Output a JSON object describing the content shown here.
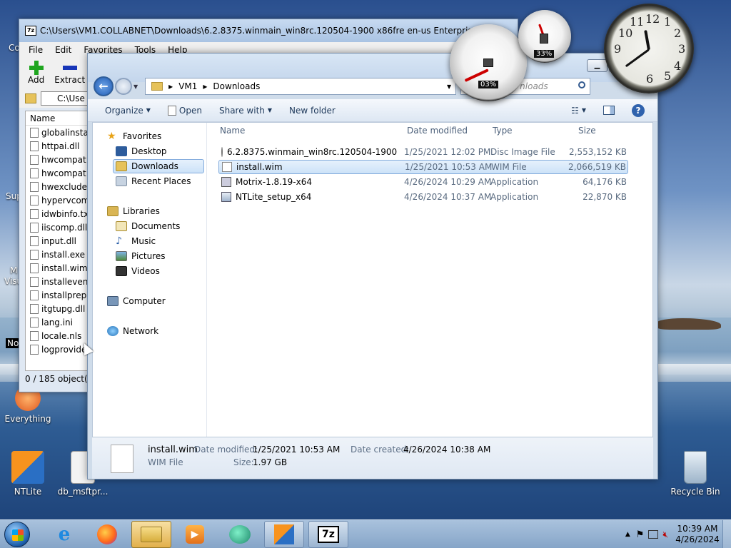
{
  "desktop": {
    "icons": [
      {
        "label": "Everything"
      },
      {
        "label": "NTLite"
      },
      {
        "label": "db_msftpr..."
      },
      {
        "label": "Recycle Bin"
      }
    ],
    "edge_labels": [
      "Co",
      "Sup",
      "M",
      "Visu",
      "No"
    ]
  },
  "sevenzip": {
    "title": "C:\\Users\\VM1.COLLABNET\\Downloads\\6.2.8375.winmain_win8rc.120504-1900 x86fre en-us Enterprise.iso\\sources\\",
    "menu": [
      "File",
      "Edit",
      "Favorites",
      "Tools",
      "Help"
    ],
    "toolbar": {
      "add": "Add",
      "extract": "Extract"
    },
    "address": "C:\\Use",
    "column_name": "Name",
    "files": [
      "globalinstall",
      "httpai.dll",
      "hwcompat.d",
      "hwcompat.t",
      "hwexclude.t",
      "hypervcomp",
      "idwbinfo.txt",
      "iiscomp.dll",
      "input.dll",
      "install.exe",
      "install.wim",
      "installeventr",
      "installprep.e",
      "itgtupg.dll",
      "lang.ini",
      "locale.nls",
      "logprovide"
    ],
    "status": "0 / 185 object(s)"
  },
  "explorer": {
    "breadcrumb": [
      "VM1",
      "Downloads"
    ],
    "search_placeholder": "Search Downloads",
    "search_visible": "nloads",
    "commands": {
      "organize": "Organize",
      "open": "Open",
      "share_with": "Share with",
      "new_folder": "New folder"
    },
    "nav": {
      "favorites": "Favorites",
      "desktop": "Desktop",
      "downloads": "Downloads",
      "recent": "Recent Places",
      "libraries": "Libraries",
      "documents": "Documents",
      "music": "Music",
      "pictures": "Pictures",
      "videos": "Videos",
      "computer": "Computer",
      "network": "Network"
    },
    "columns": {
      "name": "Name",
      "date": "Date modified",
      "type": "Type",
      "size": "Size"
    },
    "files": [
      {
        "name": "6.2.8375.winmain_win8rc.120504-1900 x8...",
        "date": "1/25/2021 12:02 PM",
        "type": "Disc Image File",
        "size": "2,553,152 KB"
      },
      {
        "name": "install.wim",
        "date": "1/25/2021 10:53 AM",
        "type": "WIM File",
        "size": "2,066,519 KB"
      },
      {
        "name": "Motrix-1.8.19-x64",
        "date": "4/26/2024 10:29 AM",
        "type": "Application",
        "size": "64,176 KB"
      },
      {
        "name": "NTLite_setup_x64",
        "date": "4/26/2024 10:37 AM",
        "type": "Application",
        "size": "22,870 KB"
      }
    ],
    "details": {
      "name": "install.wim",
      "type": "WIM File",
      "date_modified_label": "Date modified:",
      "date_modified": "1/25/2021 10:53 AM",
      "date_created_label": "Date created:",
      "date_created": "4/26/2024 10:38 AM",
      "size_label": "Size:",
      "size": "1.97 GB"
    }
  },
  "gadgets": {
    "cpu": "03%",
    "mem": "33%"
  },
  "taskbar": {
    "time": "10:39 AM",
    "date": "4/26/2024",
    "sevenzip_label": "7z"
  }
}
